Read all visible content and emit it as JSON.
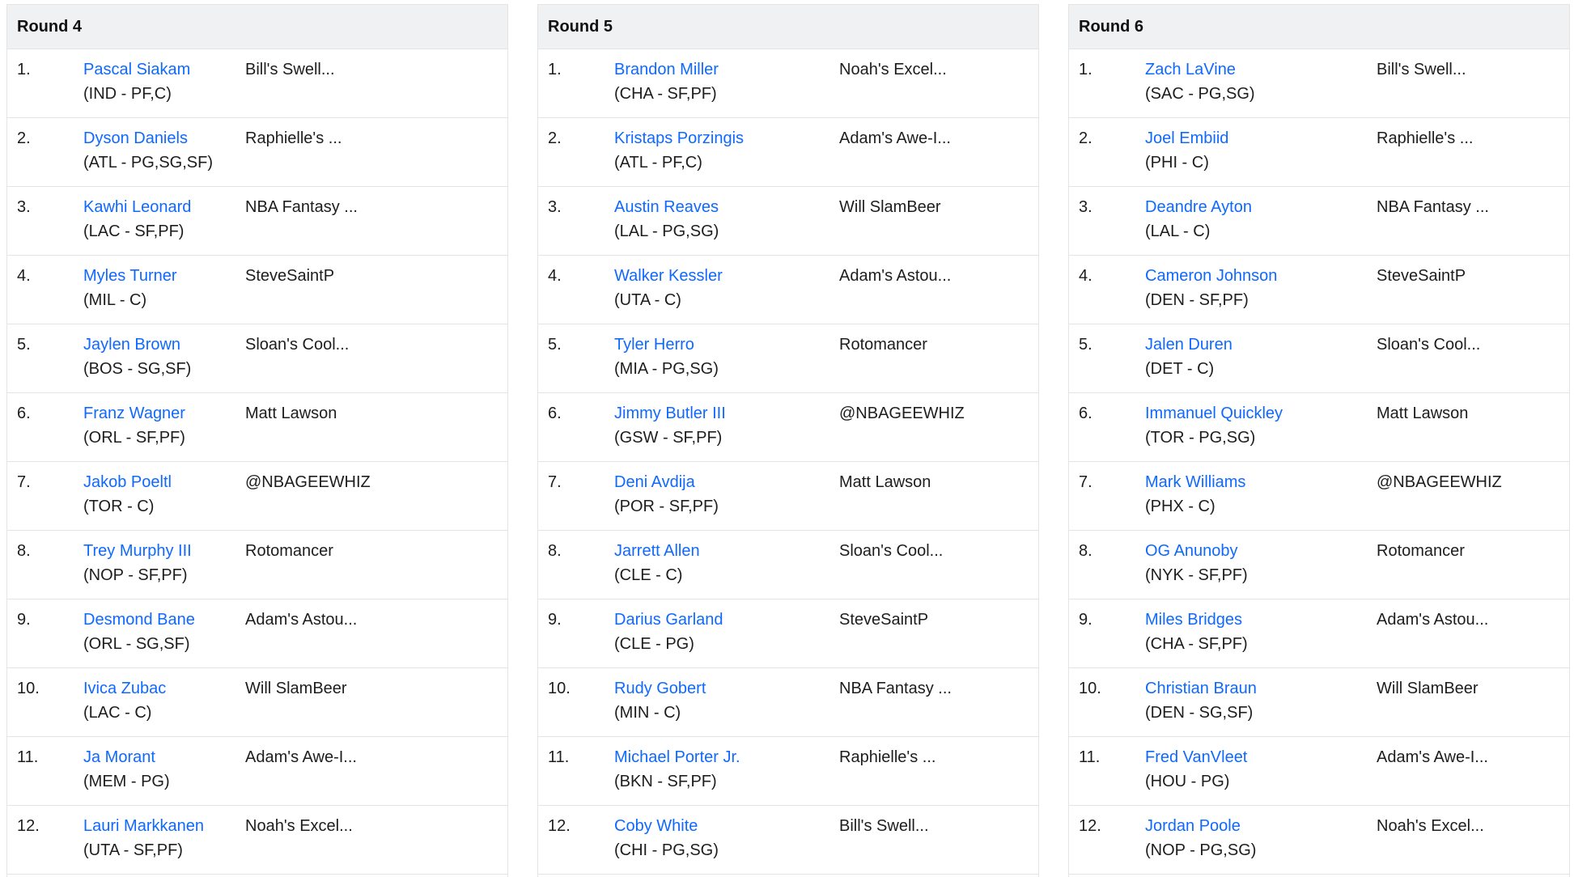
{
  "rounds": [
    {
      "title": "Round 4",
      "picks": [
        {
          "num": "1.",
          "player": "Pascal Siakam",
          "meta": "(IND - PF,C)",
          "team": "Bill's Swell..."
        },
        {
          "num": "2.",
          "player": "Dyson Daniels",
          "meta": "(ATL - PG,SG,SF)",
          "team": "Raphielle's ..."
        },
        {
          "num": "3.",
          "player": "Kawhi Leonard",
          "meta": "(LAC - SF,PF)",
          "team": "NBA Fantasy ..."
        },
        {
          "num": "4.",
          "player": "Myles Turner",
          "meta": "(MIL - C)",
          "team": "SteveSaintP"
        },
        {
          "num": "5.",
          "player": "Jaylen Brown",
          "meta": "(BOS - SG,SF)",
          "team": "Sloan's Cool..."
        },
        {
          "num": "6.",
          "player": "Franz Wagner",
          "meta": "(ORL - SF,PF)",
          "team": "Matt Lawson"
        },
        {
          "num": "7.",
          "player": "Jakob Poeltl",
          "meta": "(TOR - C)",
          "team": "@NBAGEEWHIZ"
        },
        {
          "num": "8.",
          "player": "Trey Murphy III",
          "meta": "(NOP - SF,PF)",
          "team": "Rotomancer"
        },
        {
          "num": "9.",
          "player": "Desmond Bane",
          "meta": "(ORL - SG,SF)",
          "team": "Adam's Astou..."
        },
        {
          "num": "10.",
          "player": "Ivica Zubac",
          "meta": "(LAC - C)",
          "team": "Will SlamBeer"
        },
        {
          "num": "11.",
          "player": "Ja Morant",
          "meta": "(MEM - PG)",
          "team": "Adam's Awe-I..."
        },
        {
          "num": "12.",
          "player": "Lauri Markkanen",
          "meta": "(UTA - SF,PF)",
          "team": "Noah's Excel..."
        }
      ]
    },
    {
      "title": "Round 5",
      "picks": [
        {
          "num": "1.",
          "player": "Brandon Miller",
          "meta": "(CHA - SF,PF)",
          "team": "Noah's Excel..."
        },
        {
          "num": "2.",
          "player": "Kristaps Porzingis",
          "meta": "(ATL - PF,C)",
          "team": "Adam's Awe-I..."
        },
        {
          "num": "3.",
          "player": "Austin Reaves",
          "meta": "(LAL - PG,SG)",
          "team": "Will SlamBeer"
        },
        {
          "num": "4.",
          "player": "Walker Kessler",
          "meta": "(UTA - C)",
          "team": "Adam's Astou..."
        },
        {
          "num": "5.",
          "player": "Tyler Herro",
          "meta": "(MIA - PG,SG)",
          "team": "Rotomancer"
        },
        {
          "num": "6.",
          "player": "Jimmy Butler III",
          "meta": "(GSW - SF,PF)",
          "team": "@NBAGEEWHIZ"
        },
        {
          "num": "7.",
          "player": "Deni Avdija",
          "meta": "(POR - SF,PF)",
          "team": "Matt Lawson"
        },
        {
          "num": "8.",
          "player": "Jarrett Allen",
          "meta": "(CLE - C)",
          "team": "Sloan's Cool..."
        },
        {
          "num": "9.",
          "player": "Darius Garland",
          "meta": "(CLE - PG)",
          "team": "SteveSaintP"
        },
        {
          "num": "10.",
          "player": "Rudy Gobert",
          "meta": "(MIN - C)",
          "team": "NBA Fantasy ..."
        },
        {
          "num": "11.",
          "player": "Michael Porter Jr.",
          "meta": "(BKN - SF,PF)",
          "team": "Raphielle's ..."
        },
        {
          "num": "12.",
          "player": "Coby White",
          "meta": "(CHI - PG,SG)",
          "team": "Bill's Swell..."
        }
      ]
    },
    {
      "title": "Round 6",
      "picks": [
        {
          "num": "1.",
          "player": "Zach LaVine",
          "meta": "(SAC - PG,SG)",
          "team": "Bill's Swell..."
        },
        {
          "num": "2.",
          "player": "Joel Embiid",
          "meta": "(PHI - C)",
          "team": "Raphielle's ..."
        },
        {
          "num": "3.",
          "player": "Deandre Ayton",
          "meta": "(LAL - C)",
          "team": "NBA Fantasy ..."
        },
        {
          "num": "4.",
          "player": "Cameron Johnson",
          "meta": "(DEN - SF,PF)",
          "team": "SteveSaintP"
        },
        {
          "num": "5.",
          "player": "Jalen Duren",
          "meta": "(DET - C)",
          "team": "Sloan's Cool..."
        },
        {
          "num": "6.",
          "player": "Immanuel Quickley",
          "meta": "(TOR - PG,SG)",
          "team": "Matt Lawson"
        },
        {
          "num": "7.",
          "player": "Mark Williams",
          "meta": "(PHX - C)",
          "team": "@NBAGEEWHIZ"
        },
        {
          "num": "8.",
          "player": "OG Anunoby",
          "meta": "(NYK - SF,PF)",
          "team": "Rotomancer"
        },
        {
          "num": "9.",
          "player": "Miles Bridges",
          "meta": "(CHA - SF,PF)",
          "team": "Adam's Astou..."
        },
        {
          "num": "10.",
          "player": "Christian Braun",
          "meta": "(DEN - SG,SF)",
          "team": "Will SlamBeer"
        },
        {
          "num": "11.",
          "player": "Fred VanVleet",
          "meta": "(HOU - PG)",
          "team": "Adam's Awe-I..."
        },
        {
          "num": "12.",
          "player": "Jordan Poole",
          "meta": "(NOP - PG,SG)",
          "team": "Noah's Excel..."
        }
      ]
    }
  ]
}
